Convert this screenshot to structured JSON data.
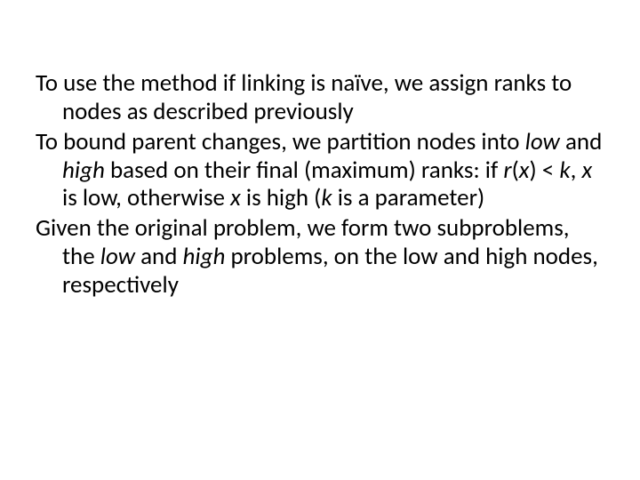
{
  "p1a": "To use the method if linking is naïve, we assign ranks to nodes as described previously",
  "p2a": "To bound parent changes, we partition nodes into ",
  "p2b": "low",
  "p2c": " and ",
  "p2d": "high",
  "p2e": " based on their final (maximum) ranks: if ",
  "p2f": "r",
  "p2g": "(",
  "p2h": "x",
  "p2i": ") < ",
  "p2j": "k",
  "p2k": ", ",
  "p2l": "x",
  "p2m": " is low, otherwise ",
  "p2n": "x",
  "p2o": " is high (",
  "p2p": "k",
  "p2q": " is a parameter)",
  "p3a": "Given the original problem, we form two subproblems, the ",
  "p3b": "low",
  "p3c": " and ",
  "p3d": "high",
  "p3e": " problems, on the low and high nodes, respectively"
}
